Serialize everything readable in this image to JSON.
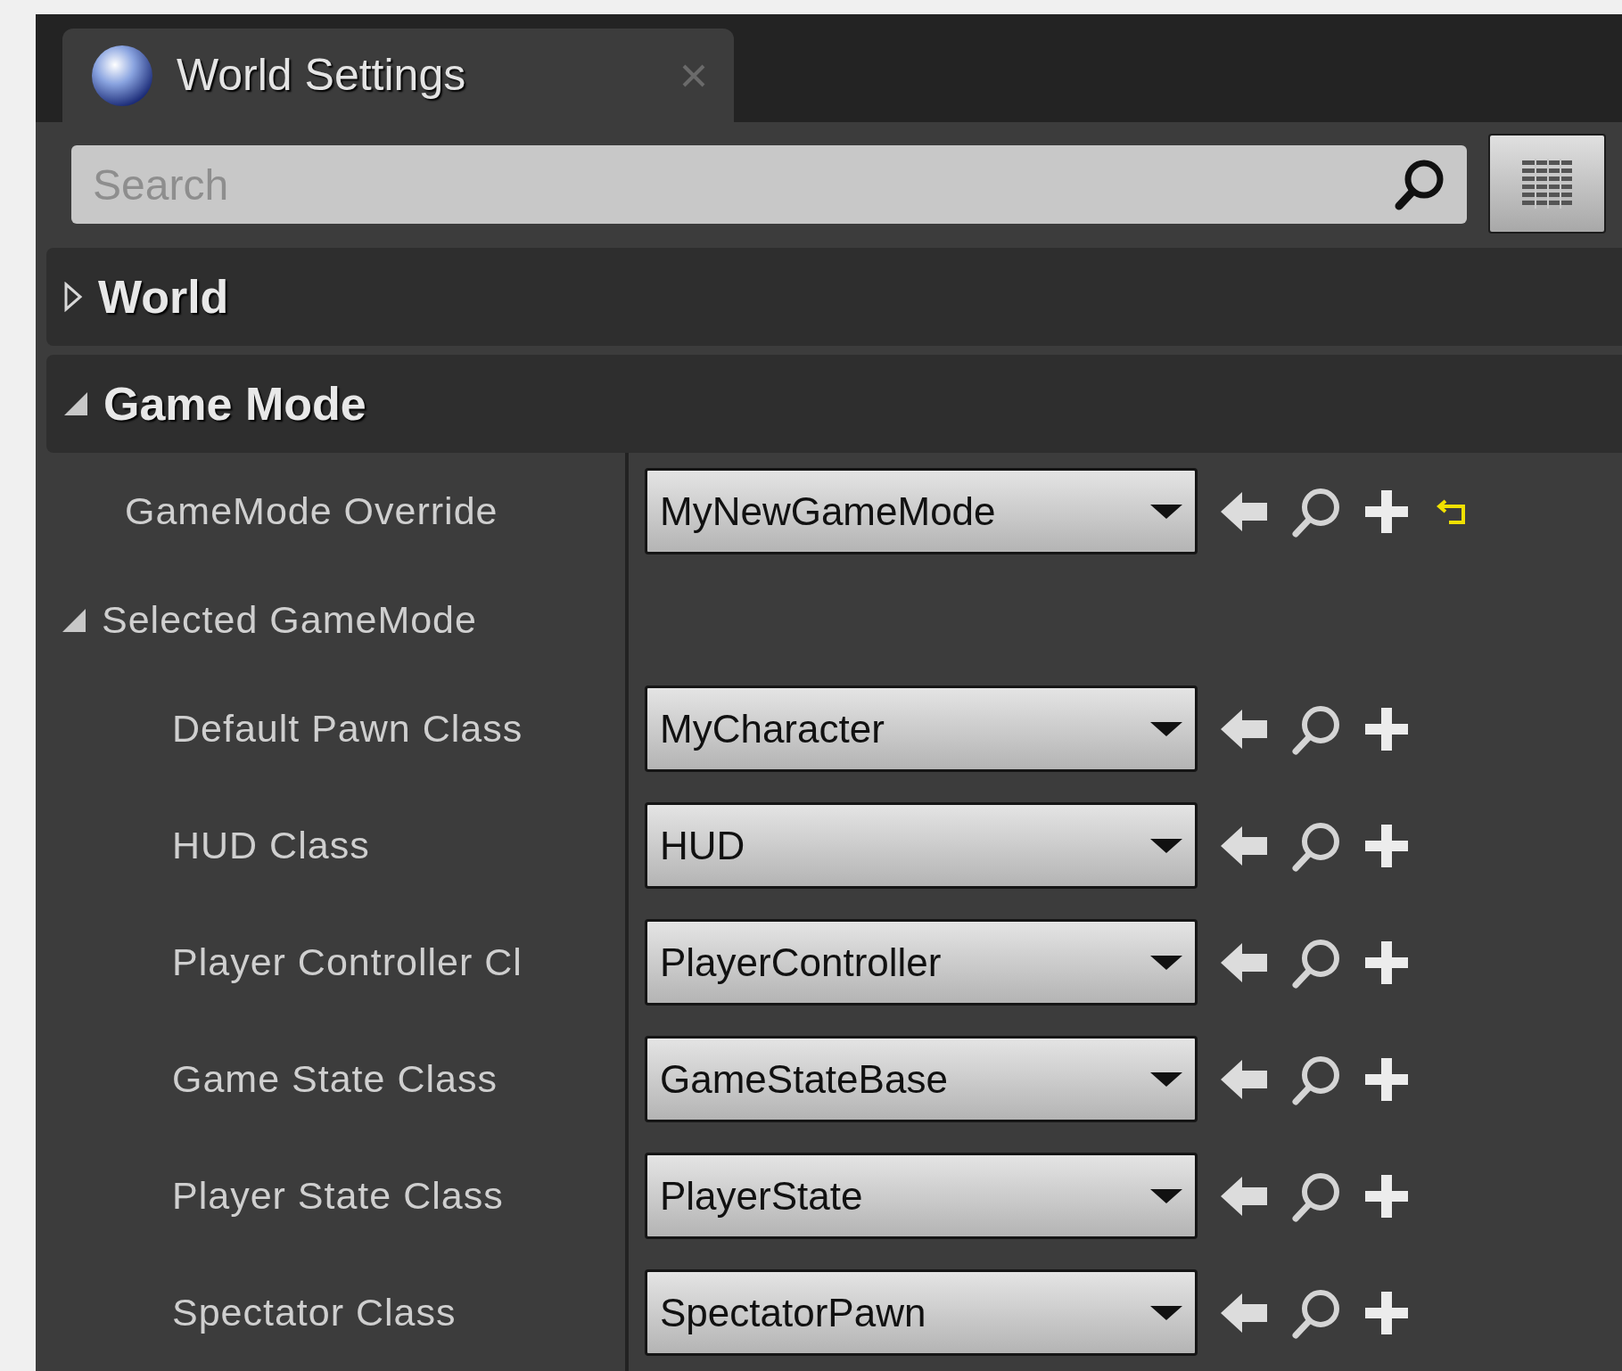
{
  "tab": {
    "title": "World Settings"
  },
  "search": {
    "placeholder": "Search"
  },
  "categories": [
    {
      "title": "World",
      "expanded": false
    },
    {
      "title": "Game Mode",
      "expanded": true,
      "properties": [
        {
          "kind": "class",
          "label": "GameMode Override",
          "value": "MyNewGameMode",
          "reset": true
        },
        {
          "kind": "group",
          "label": "Selected GameMode",
          "expanded": true,
          "children": [
            {
              "kind": "class",
              "label": "Default Pawn Class",
              "value": "MyCharacter",
              "reset": false
            },
            {
              "kind": "class",
              "label": "HUD Class",
              "value": "HUD",
              "reset": false
            },
            {
              "kind": "class",
              "label": "Player Controller Cl",
              "value": "PlayerController",
              "reset": false
            },
            {
              "kind": "class",
              "label": "Game State Class",
              "value": "GameStateBase",
              "reset": false
            },
            {
              "kind": "class",
              "label": "Player State Class",
              "value": "PlayerState",
              "reset": false
            },
            {
              "kind": "class",
              "label": "Spectator Class",
              "value": "SpectatorPawn",
              "reset": false
            }
          ]
        }
      ]
    }
  ]
}
